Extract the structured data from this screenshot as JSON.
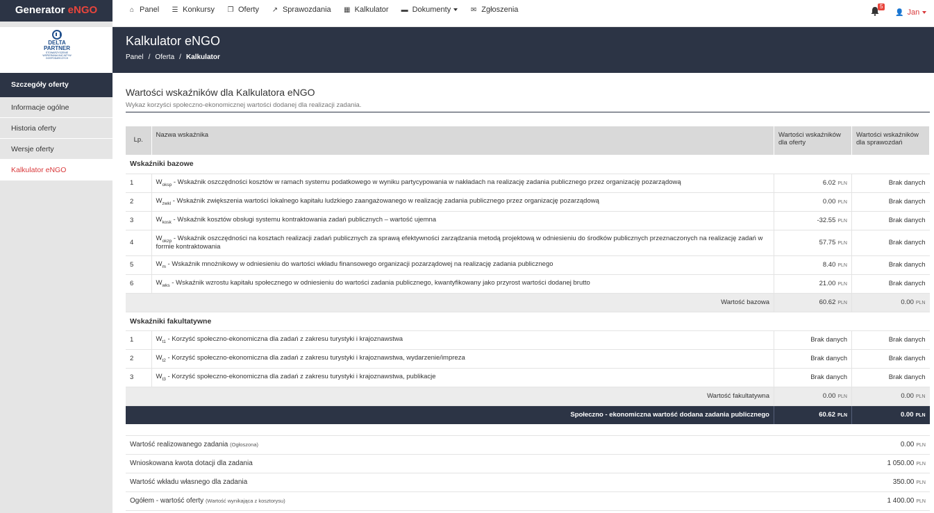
{
  "app": {
    "brand_main": "Generator ",
    "brand_accent": "eNGO"
  },
  "nav": [
    {
      "icon": "home-icon",
      "glyph": "⌂",
      "label": "Panel"
    },
    {
      "icon": "list-icon",
      "glyph": "☰",
      "label": "Konkursy"
    },
    {
      "icon": "copy-icon",
      "glyph": "❐",
      "label": "Oferty"
    },
    {
      "icon": "external-link-icon",
      "glyph": "↗",
      "label": "Sprawozdania"
    },
    {
      "icon": "calculator-icon",
      "glyph": "▦",
      "label": "Kalkulator"
    },
    {
      "icon": "folder-open-icon",
      "glyph": "▬",
      "label": "Dokumenty"
    },
    {
      "icon": "envelope-icon",
      "glyph": "✉",
      "label": "Zgłoszenia"
    }
  ],
  "notifications": {
    "count": "5"
  },
  "user": {
    "name": "Jan"
  },
  "logo": {
    "line1": "DELTA",
    "line2": "PARTNER",
    "tag": "STOWARZYSZENIE WSPIERANIA INICJATYW GOSPODARCZYCH"
  },
  "sidebar": {
    "title": "Szczegóły oferty",
    "items": [
      {
        "label": "Informacje ogólne"
      },
      {
        "label": "Historia oferty"
      },
      {
        "label": "Wersje oferty"
      },
      {
        "label": "Kalkulator eNGO"
      }
    ]
  },
  "header": {
    "title": "Kalkulator eNGO",
    "breadcrumbs": [
      "Panel",
      "/",
      "Oferta",
      "/",
      "Kalkulator"
    ]
  },
  "section": {
    "title": "Wartości wskaźników dla Kalkulatora eNGO",
    "subtitle": "Wykaz korzyści społeczno-ekonomicznej wartości dodanej dla realizacji zadania."
  },
  "table": {
    "headers": {
      "lp": "Lp.",
      "name": "Nazwa wskaźnika",
      "v1_a": "Wartości wskaźników",
      "v1_b": "dla oferty",
      "v2_a": "Wartości wskaźników",
      "v2_b": "dla sprawozdań"
    },
    "currency": "PLN",
    "base_group": "Wskaźniki bazowe",
    "base_rows": [
      {
        "lp": "1",
        "w": "W",
        "sub": "oksp",
        "text": " - Wskaźnik oszczędności kosztów w ramach systemu podatkowego w wyniku partycypowania w nakładach na realizację zadania publicznego przez organizację pozarządową",
        "v1": "6.02",
        "v2": "Brak danych"
      },
      {
        "lp": "2",
        "w": "W",
        "sub": "zwkl",
        "text": " - Wskaźnik zwiększenia wartości lokalnego kapitału ludzkiego zaangażowanego w realizację zadania publicznego przez organizację pozarządową",
        "v1": "0.00",
        "v2": "Brak danych"
      },
      {
        "lp": "3",
        "w": "W",
        "sub": "kosk",
        "text": " - Wskaźnik kosztów obsługi systemu kontraktowania zadań publicznych – wartość ujemna",
        "v1": "-32.55",
        "v2": "Brak danych"
      },
      {
        "lp": "4",
        "w": "W",
        "sub": "okzp",
        "text": " - Wskaźnik oszczędności na kosztach realizacji zadań publicznych za sprawą efektywności zarządzania metodą projektową w odniesieniu do środków publicznych przeznaczonych na realizację zadań w formie kontraktowania",
        "v1": "57.75",
        "v2": "Brak danych"
      },
      {
        "lp": "5",
        "w": "W",
        "sub": "m",
        "text": " - Wskaźnik mnożnikowy w odniesieniu do wartości wkładu finansowego organizacji pozarządowej na realizację zadania publicznego",
        "v1": "8.40",
        "v2": "Brak danych"
      },
      {
        "lp": "6",
        "w": "W",
        "sub": "wks",
        "text": " - Wskaźnik wzrostu kapitału społecznego w odniesieniu do wartości zadania publicznego, kwantyfikowany jako przyrost wartości dodanej brutto",
        "v1": "21.00",
        "v2": "Brak danych"
      }
    ],
    "base_sum": {
      "label": "Wartość bazowa",
      "v1": "60.62",
      "v2": "0.00"
    },
    "opt_group": "Wskaźniki fakultatywne",
    "opt_rows": [
      {
        "lp": "1",
        "w": "W",
        "sub": "t1",
        "text": " - Korzyść społeczno-ekonomiczna dla zadań z zakresu turystyki i krajoznawstwa",
        "v1": "Brak danych",
        "v2": "Brak danych"
      },
      {
        "lp": "2",
        "w": "W",
        "sub": "t2",
        "text": " - Korzyść społeczno-ekonomiczna dla zadań z zakresu turystyki i krajoznawstwa, wydarzenie/impreza",
        "v1": "Brak danych",
        "v2": "Brak danych"
      },
      {
        "lp": "3",
        "w": "W",
        "sub": "t3",
        "text": " - Korzyść społeczno-ekonomiczna dla zadań z zakresu turystyki i krajoznawstwa, publikacje",
        "v1": "Brak danych",
        "v2": "Brak danych"
      }
    ],
    "opt_sum": {
      "label": "Wartość fakultatywna",
      "v1": "0.00",
      "v2": "0.00"
    },
    "total": {
      "label": "Społeczno - ekonomiczna wartość dodana zadania publicznego",
      "v1": "60.62",
      "v2": "0.00"
    }
  },
  "summary": [
    {
      "label": "Wartość realizowanego zadania",
      "note": "(Ogłoszona)",
      "value": "0.00"
    },
    {
      "label": "Wnioskowana kwota dotacji dla zadania",
      "note": "",
      "value": "1 050.00"
    },
    {
      "label": "Wartość wkładu własnego dla zadania",
      "note": "",
      "value": "350.00"
    },
    {
      "label": "Ogółem - wartość oferty",
      "note": "(Wartość wynikająca z kosztorysu)",
      "value": "1 400.00"
    }
  ]
}
